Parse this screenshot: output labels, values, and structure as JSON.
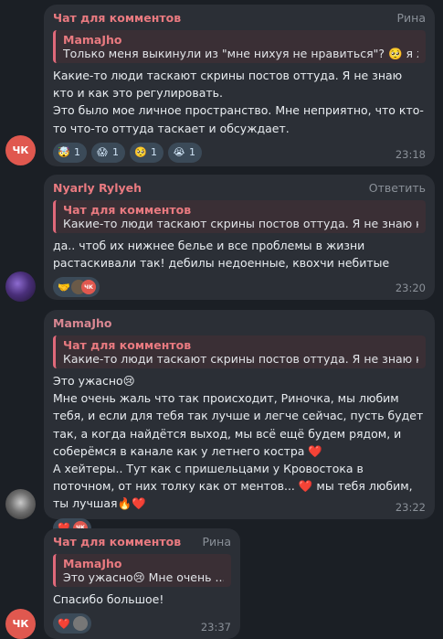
{
  "messages": [
    {
      "sender": "Чат для комментов",
      "author": "Рина",
      "reply": {
        "name": "MamaJho",
        "text": "Только меня выкинули из \"мне нихуя не нравиться\"? 🥺 я ж..."
      },
      "text": "Какие-то люди таскают скрины постов оттуда. Я не знаю кто и как это регулировать.\nЭто было мое личное пространство. Мне неприятно, что кто-то что-то оттуда таскает и обсуждает.",
      "reactions": [
        {
          "emoji": "🤯",
          "count": "1"
        },
        {
          "emoji": "😱",
          "count": "1"
        },
        {
          "emoji": "🥺",
          "count": "1"
        },
        {
          "emoji": "😭",
          "count": "1"
        }
      ],
      "time": "23:18",
      "avatar": "ЧК"
    },
    {
      "sender": "Nyarly Rylyeh",
      "action": "Ответить",
      "reply": {
        "name": "Чат для комментов",
        "text": "Какие-то люди таскают скрины постов оттуда. Я не знаю кто ..."
      },
      "text": "да.. чтоб их нижнее белье и все проблемы в жизни растаскивали так! дебилы недоенные, квохчи небитые",
      "reactions": [
        {
          "emoji": "🤝",
          "count": ""
        }
      ],
      "reaction_avatar_label": "ЧК",
      "time": "23:20"
    },
    {
      "sender": "MamaJho",
      "reply": {
        "name": "Чат для комментов",
        "text": "Какие-то люди таскают скрины постов оттуда. Я не знаю кто ..."
      },
      "text": "Это ужасно😢\nМне очень жаль что так происходит, Риночка, мы любим тебя, и если для тебя так лучше и легче сейчас, пусть будет так, а когда найдётся выход, мы всё ещё будем рядом, и соберёмся в канале как у летнего костра ❤️\nА хейтеры.. Тут как с пришельцами у Кровостока в поточном, от них толку как от ментов... ❤️ мы тебя любим, ты лучшая🔥❤️",
      "reactions": [
        {
          "emoji": "❤️",
          "count": ""
        }
      ],
      "reaction_avatar_label": "ЧК",
      "time": "23:22"
    },
    {
      "sender": "Чат для комментов",
      "author": "Рина",
      "reply": {
        "name": "MamaJho",
        "text": "Это ужасно😢 Мне очень ..."
      },
      "text": "Спасибо большое!",
      "reactions": [
        {
          "emoji": "❤️",
          "count": ""
        }
      ],
      "time": "23:37",
      "avatar": "ЧК"
    }
  ]
}
